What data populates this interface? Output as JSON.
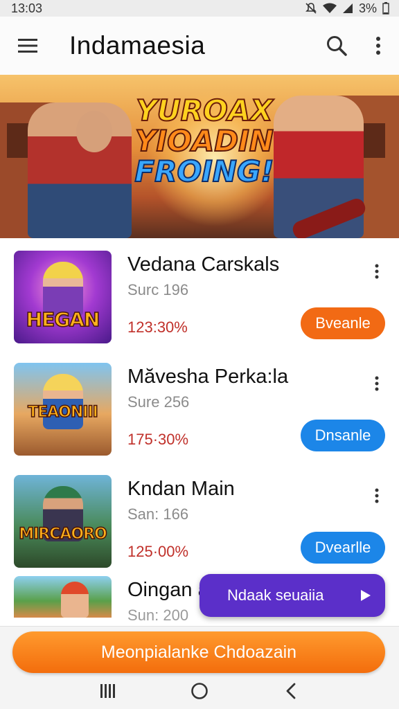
{
  "status_bar": {
    "time": "13:03",
    "battery": "3%"
  },
  "app_bar": {
    "title": "Indamaesia",
    "menu_icon": "hamburger-menu-icon",
    "search_icon": "search-icon",
    "more_icon": "more-vert-icon"
  },
  "banner": {
    "line1": "YUROAX",
    "line2": "YIOADIN",
    "line3": "FROING!"
  },
  "items": [
    {
      "title": "Vedana Carskals",
      "subtitle": "Surc 196",
      "percent": "123:30%",
      "button": "Bveanle",
      "button_color": "#f26a14",
      "thumb_label": "HEGAN"
    },
    {
      "title": "Măvesha Perka:la",
      "subtitle": "Sure 256",
      "percent": "175·30%",
      "button": "Dnsanle",
      "button_color": "#1c86e8",
      "thumb_label": "TEAONIII"
    },
    {
      "title": "Kndan Main",
      "subtitle": "San: 166",
      "percent": "125·00%",
      "button": "Dvearlle",
      "button_color": "#1c86e8",
      "thumb_label": "MIRCAORO"
    },
    {
      "title": "Oingan a",
      "subtitle": "Sun: 200"
    }
  ],
  "fab": {
    "label": "Ndaak seuaiia",
    "icon": "play-arrow-icon"
  },
  "cta": {
    "label": "Meonpialanke Chdoazain"
  },
  "nav": {
    "recents_icon": "recents-icon",
    "home_icon": "home-icon",
    "back_icon": "back-icon"
  },
  "colors": {
    "accent_orange": "#f26a14",
    "accent_blue": "#1c86e8",
    "fab_purple": "#5b2fc9",
    "percent_red": "#c0302a"
  }
}
